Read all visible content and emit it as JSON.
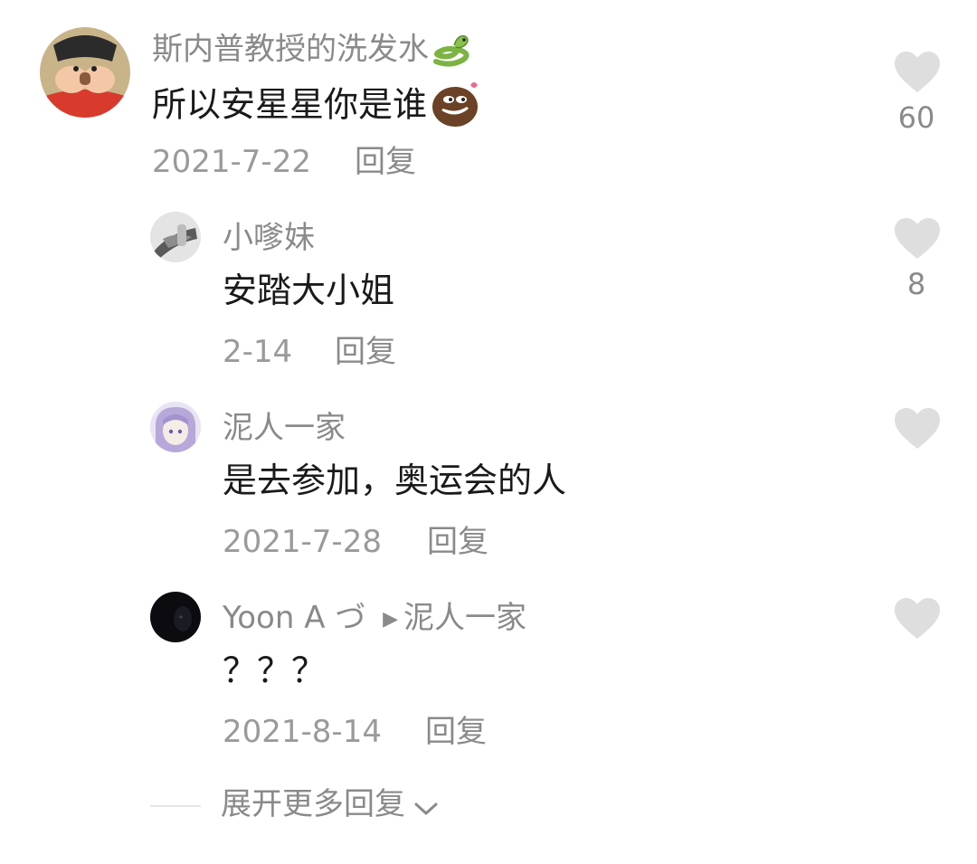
{
  "colors": {
    "text": "#1a1a1a",
    "muted": "#8a8a8a",
    "heart": "#dedede"
  },
  "comment": {
    "username": "斯内普教授的洗发水",
    "username_emoji": "snake-emoji",
    "text": "所以安星星你是谁",
    "text_emoji": "smirk-emoji",
    "date": "2021-7-22",
    "reply_label": "回复",
    "like_count": "60"
  },
  "replies": [
    {
      "username": "小嗲妹",
      "text": "安踏大小姐",
      "date": "2-14",
      "reply_label": "回复",
      "like_count": "8"
    },
    {
      "username": "泥人一家",
      "text": "是去参加，奥运会的人",
      "date": "2021-7-28",
      "reply_label": "回复",
      "like_count": ""
    },
    {
      "username": "Yoon A づ",
      "reply_to": "泥人一家",
      "text": "？？？",
      "date": "2021-8-14",
      "reply_label": "回复",
      "like_count": ""
    }
  ],
  "expand": {
    "label": "展开更多回复"
  }
}
